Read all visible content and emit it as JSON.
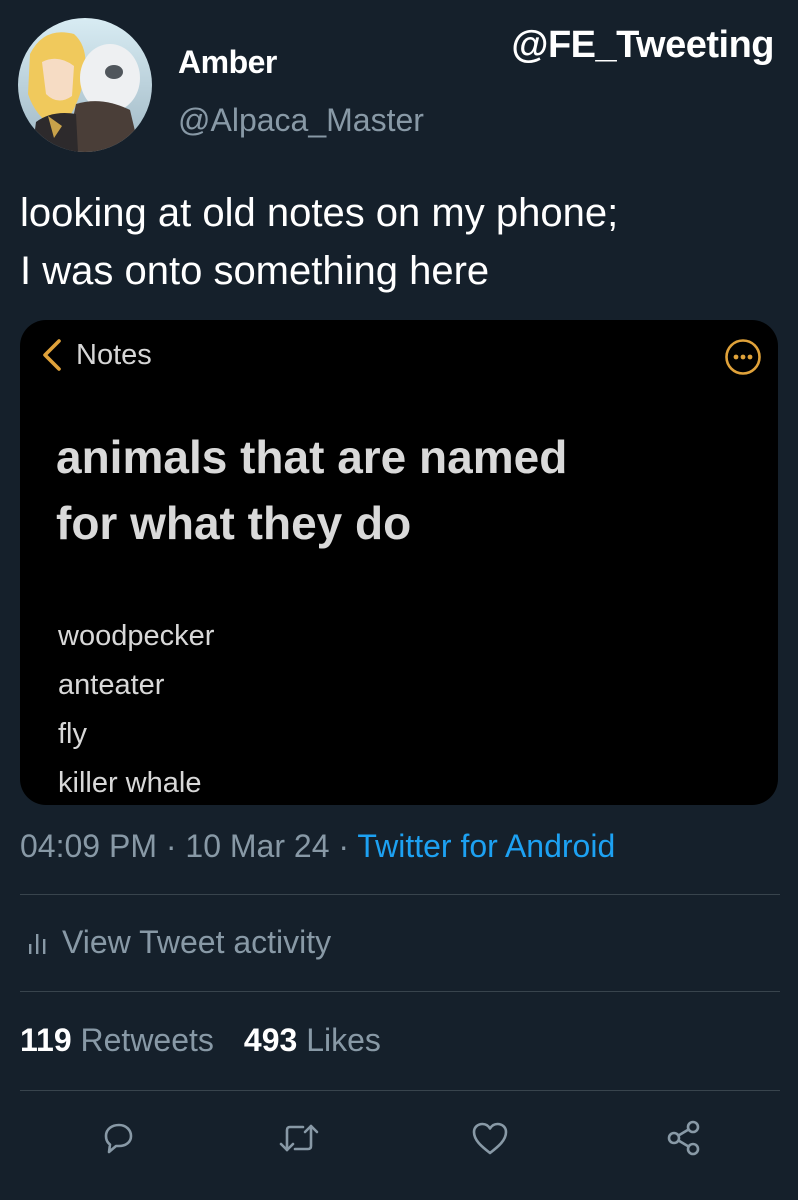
{
  "watermark": "@FE_Tweeting",
  "tweet": {
    "author": {
      "display_name": "Amber",
      "handle": "@Alpaca_Master"
    },
    "text_lines": [
      "looking at old notes on my phone;",
      "I was onto something here"
    ],
    "image": {
      "back_label": "Notes",
      "title_lines": [
        "animals that are named",
        "for what they do"
      ],
      "items": [
        "woodpecker",
        "anteater",
        "fly",
        "killer whale"
      ]
    },
    "time": "04:09 PM",
    "date": "10 Mar 24",
    "separator": "·",
    "source": "Twitter for Android",
    "activity_label": "View Tweet activity",
    "retweets_count": "119",
    "retweets_label": "Retweets",
    "likes_count": "493",
    "likes_label": "Likes"
  },
  "icons": {
    "reply": "reply-icon",
    "retweet": "retweet-icon",
    "like": "like-icon",
    "share": "share-icon",
    "activity": "bar-chart-icon",
    "back": "chevron-left-icon",
    "more": "more-icon"
  },
  "colors": {
    "background": "#15202b",
    "text": "#ffffff",
    "secondary_text": "#8899a6",
    "link": "#1da1f2",
    "divider": "#38444d",
    "note_background": "#000000"
  }
}
